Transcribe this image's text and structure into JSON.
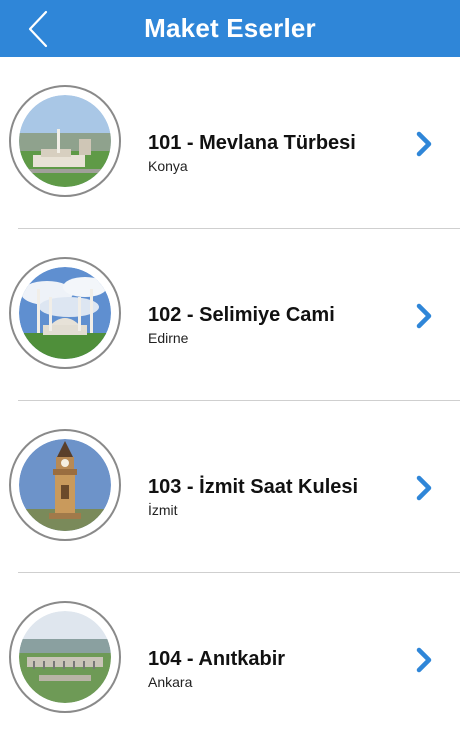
{
  "header": {
    "title": "Maket Eserler",
    "back_icon": "chevron-left-icon",
    "background_color": "#2f86d8"
  },
  "items": [
    {
      "title": "101 - Mevlana Türbesi",
      "subtitle": "Konya",
      "icon": "chevron-right-icon"
    },
    {
      "title": "102 - Selimiye Cami",
      "subtitle": "Edirne",
      "icon": "chevron-right-icon"
    },
    {
      "title": "103 - İzmit Saat Kulesi",
      "subtitle": "İzmit",
      "icon": "chevron-right-icon"
    },
    {
      "title": "104 - Anıtkabir",
      "subtitle": "Ankara",
      "icon": "chevron-right-icon"
    }
  ],
  "accent_color": "#2f86d8"
}
